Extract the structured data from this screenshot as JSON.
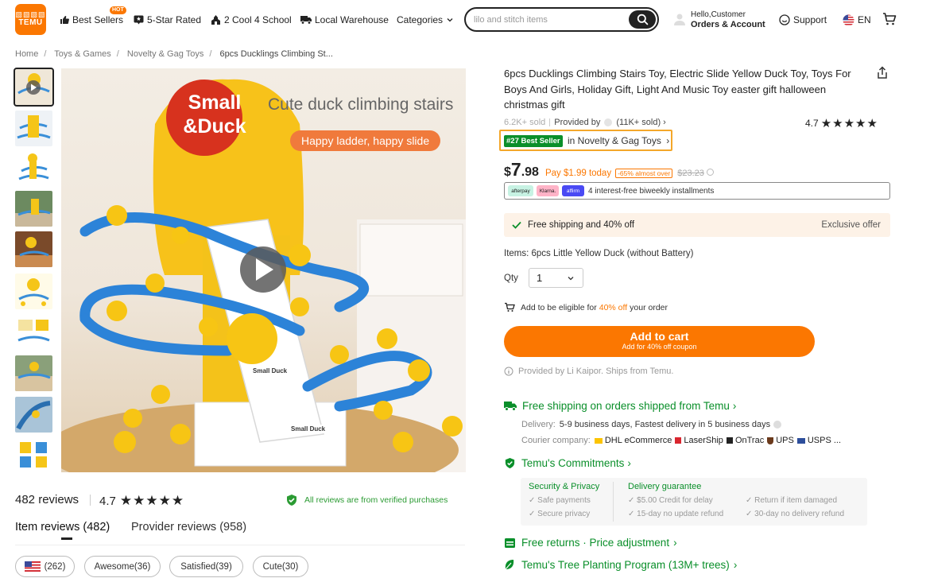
{
  "header": {
    "logo_glyphs": "▧▧▧▧",
    "logo_text": "TEMU",
    "hot_badge": "HOT",
    "nav": [
      "Best Sellers",
      "5-Star Rated",
      "2 Cool 4 School",
      "Local Warehouse",
      "Categories"
    ],
    "search_placeholder": "lilo and stitch items",
    "account_line1": "Hello,Customer",
    "account_line2": "Orders & Account",
    "support": "Support",
    "language": "EN"
  },
  "breadcrumb": [
    "Home",
    "Toys & Games",
    "Novelty & Gag Toys",
    "6pcs Ducklings Climbing St..."
  ],
  "image": {
    "tagline": "Cute duck climbing stairs",
    "subtag": "Happy ladder, happy slide",
    "sign_line1": "Small",
    "sign_line2": "&Duck",
    "box_label": "Small Duck",
    "box_label2": "Small Duck"
  },
  "reviews": {
    "count": "482 reviews",
    "rating": "4.7",
    "verified": "All reviews are from verified purchases",
    "tab_items": "Item reviews (482)",
    "tab_provider": "Provider reviews (958)",
    "chips": [
      "(262)",
      "Awesome(36)",
      "Satisfied(39)",
      "Cute(30)"
    ]
  },
  "product": {
    "title": "6pcs Ducklings Climbing Stairs Toy, Electric Slide Yellow Duck Toy, Toys For Boys And Girls, Holiday Gift, Light And Music Toy easter gift halloween christmas gift",
    "sold": "6.2K+ sold",
    "provided_by": "Provided by",
    "provider_sold": "(11K+ sold)",
    "rating": "4.7",
    "best_seller_rank": "#27 Best Seller",
    "best_seller_category": "in Novelty & Gag Toys",
    "price_dollar": "$",
    "price_main": "7",
    "price_cents": ".98",
    "pay_today": "Pay $1.99 today",
    "discount_tag": "-65% almost over",
    "original_price": "$23.23",
    "pay_logos": [
      "afterpay",
      "Klarna.",
      "affirm"
    ],
    "installments": "4 interest-free biweekly installments",
    "shipping_offer": "Free shipping and 40% off",
    "exclusive": "Exclusive offer",
    "items_label": "Items: 6pcs Little Yellow Duck (without Battery)",
    "qty_label": "Qty",
    "qty_value": "1",
    "eligible_pre": "Add to be eligible for",
    "eligible_pct": "40% off",
    "eligible_post": "your order",
    "cart_label": "Add to cart",
    "cart_sub": "Add for 40% off coupon",
    "provided_note": "Provided by Li Kaipor. Ships from Temu."
  },
  "shipping": {
    "title": "Free shipping on orders shipped from Temu",
    "delivery_label": "Delivery:",
    "delivery_value": "5-9 business days, Fastest delivery in 5 business days",
    "courier_label": "Courier company:",
    "couriers": [
      "DHL eCommerce",
      "LaserShip",
      "OnTrac",
      "UPS",
      "USPS ..."
    ]
  },
  "commitments": {
    "title": "Temu's Commitments",
    "security_title": "Security & Privacy",
    "security_items": [
      "Safe payments",
      "Secure privacy"
    ],
    "delivery_title": "Delivery guarantee",
    "delivery_items": [
      "$5.00 Credit for delay",
      "15-day no update refund",
      "Return if item damaged",
      "30-day no delivery refund"
    ]
  },
  "returns": "Free returns · Price adjustment",
  "tree": "Temu's Tree Planting Program (13M+ trees)",
  "colors": {
    "brand": "#fb7701",
    "green": "#0a8f2a",
    "badge_border": "#f4a72a"
  }
}
